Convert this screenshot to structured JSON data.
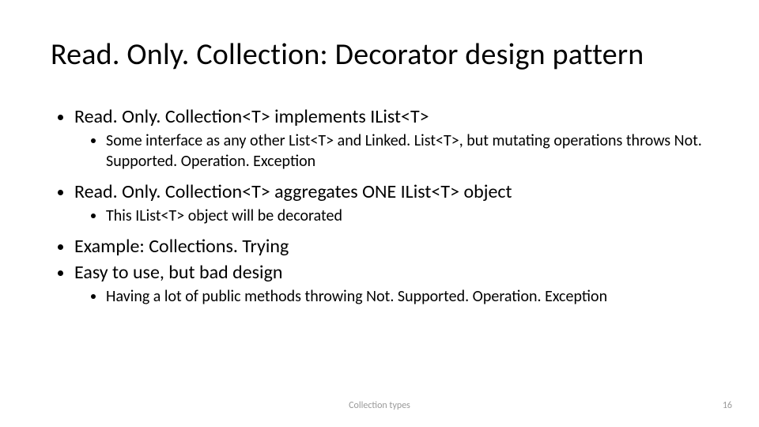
{
  "title": "Read. Only. Collection: Decorator design pattern",
  "bullets": {
    "b1": "Read. Only. Collection<T> implements IList<T>",
    "b1_1": "Some interface as any other List<T> and Linked. List<T>, but mutating operations throws Not. Supported. Operation. Exception",
    "b2": "Read. Only. Collection<T> aggregates ONE IList<T> object",
    "b2_1": "This IList<T> object will be decorated",
    "b3": "Example: Collections. Trying",
    "b4": "Easy to use, but bad design",
    "b4_1": "Having a lot of public methods throwing Not. Supported. Operation. Exception"
  },
  "footer": {
    "center": "Collection types",
    "page": "16"
  }
}
